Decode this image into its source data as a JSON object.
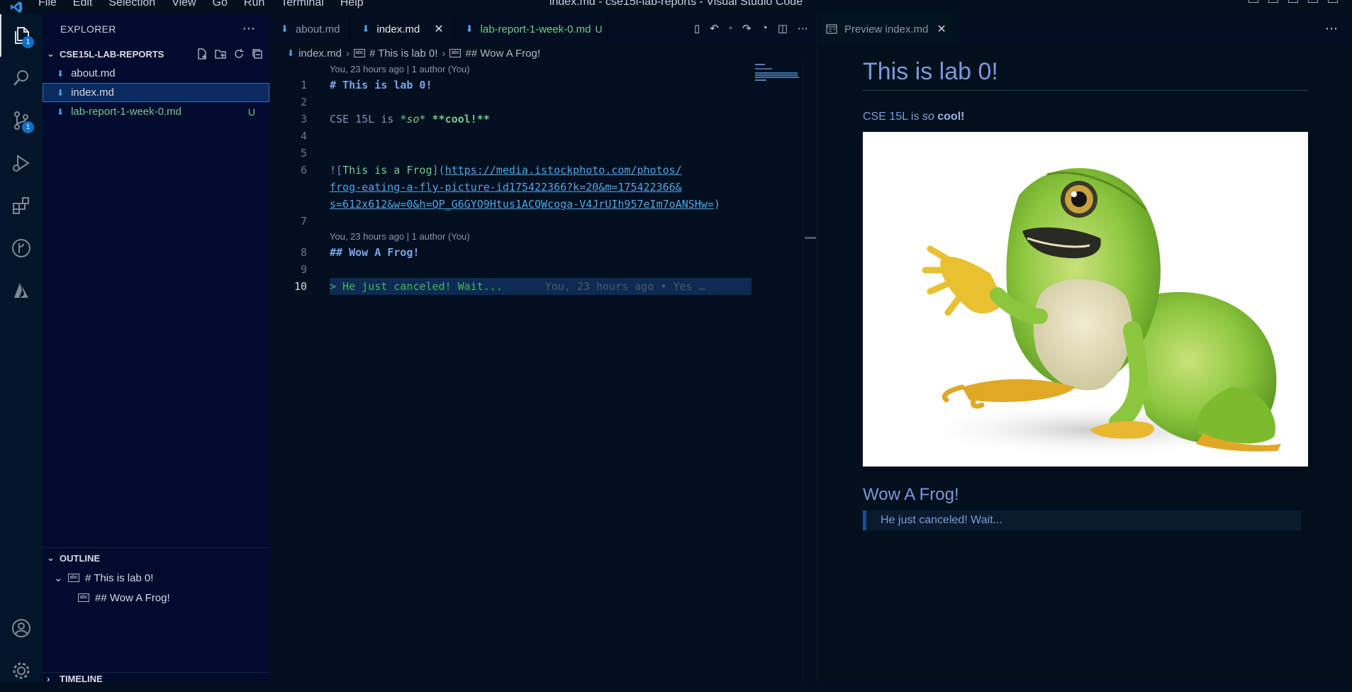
{
  "app": {
    "window_title": "index.md - cse15l-lab-reports - Visual Studio Code",
    "menu": [
      "File",
      "Edit",
      "Selection",
      "View",
      "Go",
      "Run",
      "Terminal",
      "Help"
    ]
  },
  "activity": {
    "explorer_badge": "1",
    "scm_badge": "1"
  },
  "sidebar": {
    "title": "EXPLORER",
    "folder": "CSE15L-LAB-REPORTS",
    "files": [
      {
        "name": "about.md",
        "status": ""
      },
      {
        "name": "index.md",
        "status": ""
      },
      {
        "name": "lab-report-1-week-0.md",
        "status": "U"
      }
    ],
    "outline_title": "OUTLINE",
    "outline": [
      "# This is lab 0!",
      "## Wow A Frog!"
    ],
    "timeline_title": "TIMELINE"
  },
  "tabs": [
    {
      "name": "about.md"
    },
    {
      "name": "index.md"
    },
    {
      "name": "lab-report-1-week-0.md",
      "status": "U"
    }
  ],
  "breadcrumbs": [
    "index.md",
    "# This is lab 0!",
    "## Wow A Frog!"
  ],
  "codelens": [
    "You, 23 hours ago | 1 author (You)",
    "You, 23 hours ago | 1 author (You)"
  ],
  "code": {
    "l1": "# This is lab 0!",
    "l3a": "CSE 15L is ",
    "l3b": "*so*",
    "l3c": "**cool!**",
    "l6a": "![",
    "l6b": "This is a Frog",
    "l6c": "](",
    "l6d": "https://media.istockphoto.com/photos/",
    "l6e": "frog-eating-a-fly-picture-id175422366?k=20&m=175422366&",
    "l6f": "s=612x612&w=0&h=QP_G6GYO9Htus1ACQWcoga-V4JrUIh957eIm7oANSHw=",
    "l6g": ")",
    "l8": "## Wow A Frog!",
    "l10": "> He just canceled! Wait...",
    "blame": "You, 23 hours ago • Yes …"
  },
  "line_numbers": [
    "1",
    "2",
    "3",
    "4",
    "5",
    "6",
    "7",
    "8",
    "9",
    "10"
  ],
  "preview": {
    "tab": "Preview index.md",
    "h1": "This is lab 0!",
    "p_pre": "CSE 15L is ",
    "p_em": "so",
    "p_strong": "cool!",
    "h2": "Wow A Frog!",
    "quote": "He just canceled! Wait..."
  }
}
